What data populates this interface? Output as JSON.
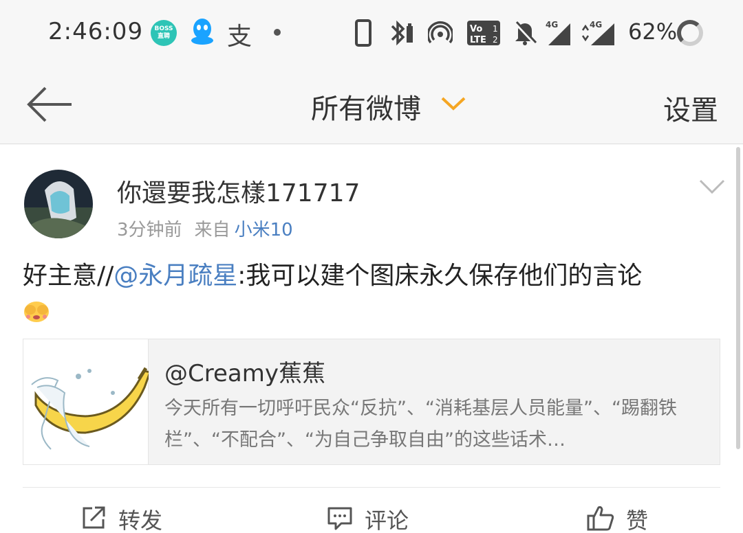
{
  "status_bar": {
    "time": "2:46:09",
    "boss_badge": [
      "BOSS",
      "直聘"
    ],
    "alipay_glyph": "支",
    "volte_label": "Vo LTE",
    "signal1_label": "4G",
    "signal2_label": "4G",
    "battery": "62%",
    "icons": [
      "boss-app-icon",
      "qq-icon",
      "alipay-icon",
      "dot-icon",
      "phone-icon",
      "bluetooth-icon",
      "hotspot-icon",
      "volte-icon",
      "mute-icon",
      "signal-icon",
      "signal-icon",
      "battery-ring-icon"
    ]
  },
  "nav": {
    "title": "所有微博",
    "settings": "设置"
  },
  "post": {
    "username": "你還要我怎樣171717",
    "time_ago": "3分钟前",
    "from_label": "来自",
    "source": "小米10",
    "text_prefix": "好主意//",
    "mention": "@永月疏星",
    "text_suffix": ":我可以建个图床永久保存他们的言论",
    "emoji": "face-covering-eyes-emoji"
  },
  "quote": {
    "author": "@Creamy蕉蕉",
    "text": "今天所有一切呼吁民众“反抗”、“消耗基层人员能量”、“踢翻铁栏”、“不配合”、“为自己争取自由”的这些话术…"
  },
  "actions": {
    "repost": "转发",
    "comment": "评论",
    "like": "赞"
  },
  "colors": {
    "link": "#4a7fc1",
    "accent_chevron": "#f5a623",
    "boss_green": "#2ec4b6",
    "qq_blue": "#1aa3ff"
  }
}
